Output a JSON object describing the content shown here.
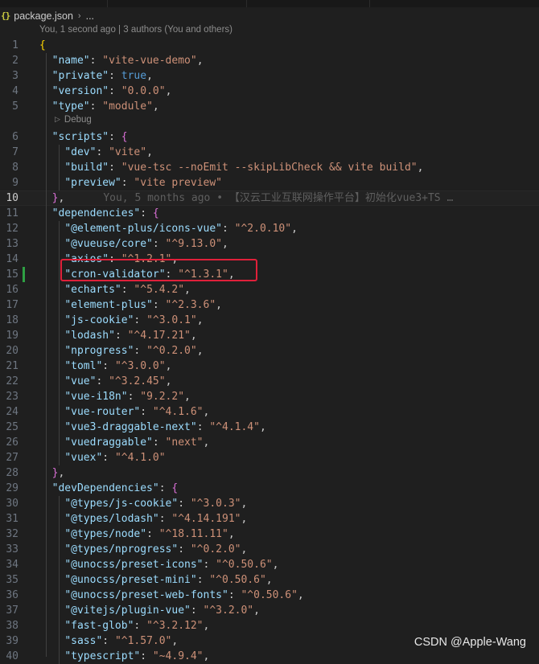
{
  "breadcrumb": {
    "file_icon": "{}",
    "file_name": "package.json",
    "separator": "›",
    "more": "..."
  },
  "blame_header": "You, 1 second ago | 3 authors (You and others)",
  "codelens": {
    "icon": "play-icon",
    "label": "Debug"
  },
  "inline_blame": "You, 5 months ago • 【汉云工业互联网操作平台】初始化vue3+TS …",
  "watermark": "CSDN @Apple-Wang",
  "colors": {
    "key": "#9cdcfe",
    "string": "#ce9178",
    "keyword": "#569cd6",
    "highlight_box": "#e0203a",
    "added_line_marker": "#2ea043"
  },
  "active_line": 10,
  "highlighted_line": 15,
  "lines": [
    {
      "n": "1",
      "t": [
        {
          "c": "br1",
          "v": "{"
        }
      ]
    },
    {
      "n": "2",
      "t": [
        {
          "c": "p",
          "v": "  "
        },
        {
          "c": "k",
          "v": "\"name\""
        },
        {
          "c": "p",
          "v": ": "
        },
        {
          "c": "s",
          "v": "\"vite-vue-demo\""
        },
        {
          "c": "p",
          "v": ","
        }
      ]
    },
    {
      "n": "3",
      "t": [
        {
          "c": "p",
          "v": "  "
        },
        {
          "c": "k",
          "v": "\"private\""
        },
        {
          "c": "p",
          "v": ": "
        },
        {
          "c": "b",
          "v": "true"
        },
        {
          "c": "p",
          "v": ","
        }
      ]
    },
    {
      "n": "4",
      "t": [
        {
          "c": "p",
          "v": "  "
        },
        {
          "c": "k",
          "v": "\"version\""
        },
        {
          "c": "p",
          "v": ": "
        },
        {
          "c": "s",
          "v": "\"0.0.0\""
        },
        {
          "c": "p",
          "v": ","
        }
      ]
    },
    {
      "n": "5",
      "t": [
        {
          "c": "p",
          "v": "  "
        },
        {
          "c": "k",
          "v": "\"type\""
        },
        {
          "c": "p",
          "v": ": "
        },
        {
          "c": "s",
          "v": "\"module\""
        },
        {
          "c": "p",
          "v": ","
        }
      ]
    },
    {
      "n": "6",
      "t": [
        {
          "c": "p",
          "v": "  "
        },
        {
          "c": "k",
          "v": "\"scripts\""
        },
        {
          "c": "p",
          "v": ": "
        },
        {
          "c": "br2",
          "v": "{"
        }
      ]
    },
    {
      "n": "7",
      "t": [
        {
          "c": "p",
          "v": "    "
        },
        {
          "c": "k",
          "v": "\"dev\""
        },
        {
          "c": "p",
          "v": ": "
        },
        {
          "c": "s",
          "v": "\"vite\""
        },
        {
          "c": "p",
          "v": ","
        }
      ]
    },
    {
      "n": "8",
      "t": [
        {
          "c": "p",
          "v": "    "
        },
        {
          "c": "k",
          "v": "\"build\""
        },
        {
          "c": "p",
          "v": ": "
        },
        {
          "c": "s",
          "v": "\"vue-tsc --noEmit --skipLibCheck && vite build\""
        },
        {
          "c": "p",
          "v": ","
        }
      ]
    },
    {
      "n": "9",
      "t": [
        {
          "c": "p",
          "v": "    "
        },
        {
          "c": "k",
          "v": "\"preview\""
        },
        {
          "c": "p",
          "v": ": "
        },
        {
          "c": "s",
          "v": "\"vite preview\""
        }
      ]
    },
    {
      "n": "10",
      "t": [
        {
          "c": "p",
          "v": "  "
        },
        {
          "c": "br2",
          "v": "}"
        },
        {
          "c": "p",
          "v": ","
        }
      ]
    },
    {
      "n": "11",
      "t": [
        {
          "c": "p",
          "v": "  "
        },
        {
          "c": "k",
          "v": "\"dependencies\""
        },
        {
          "c": "p",
          "v": ": "
        },
        {
          "c": "br2",
          "v": "{"
        }
      ]
    },
    {
      "n": "12",
      "t": [
        {
          "c": "p",
          "v": "    "
        },
        {
          "c": "k",
          "v": "\"@element-plus/icons-vue\""
        },
        {
          "c": "p",
          "v": ": "
        },
        {
          "c": "s",
          "v": "\"^2.0.10\""
        },
        {
          "c": "p",
          "v": ","
        }
      ]
    },
    {
      "n": "13",
      "t": [
        {
          "c": "p",
          "v": "    "
        },
        {
          "c": "k",
          "v": "\"@vueuse/core\""
        },
        {
          "c": "p",
          "v": ": "
        },
        {
          "c": "s",
          "v": "\"^9.13.0\""
        },
        {
          "c": "p",
          "v": ","
        }
      ]
    },
    {
      "n": "14",
      "t": [
        {
          "c": "p",
          "v": "    "
        },
        {
          "c": "k",
          "v": "\"axios\""
        },
        {
          "c": "p",
          "v": ": "
        },
        {
          "c": "s",
          "v": "\"^1.2.1\""
        },
        {
          "c": "p",
          "v": ","
        }
      ]
    },
    {
      "n": "15",
      "t": [
        {
          "c": "p",
          "v": "    "
        },
        {
          "c": "k",
          "v": "\"cron-validator\""
        },
        {
          "c": "p",
          "v": ": "
        },
        {
          "c": "s",
          "v": "\"^1.3.1\""
        },
        {
          "c": "p",
          "v": ","
        }
      ]
    },
    {
      "n": "16",
      "t": [
        {
          "c": "p",
          "v": "    "
        },
        {
          "c": "k",
          "v": "\"echarts\""
        },
        {
          "c": "p",
          "v": ": "
        },
        {
          "c": "s",
          "v": "\"^5.4.2\""
        },
        {
          "c": "p",
          "v": ","
        }
      ]
    },
    {
      "n": "17",
      "t": [
        {
          "c": "p",
          "v": "    "
        },
        {
          "c": "k",
          "v": "\"element-plus\""
        },
        {
          "c": "p",
          "v": ": "
        },
        {
          "c": "s",
          "v": "\"^2.3.6\""
        },
        {
          "c": "p",
          "v": ","
        }
      ]
    },
    {
      "n": "18",
      "t": [
        {
          "c": "p",
          "v": "    "
        },
        {
          "c": "k",
          "v": "\"js-cookie\""
        },
        {
          "c": "p",
          "v": ": "
        },
        {
          "c": "s",
          "v": "\"^3.0.1\""
        },
        {
          "c": "p",
          "v": ","
        }
      ]
    },
    {
      "n": "19",
      "t": [
        {
          "c": "p",
          "v": "    "
        },
        {
          "c": "k",
          "v": "\"lodash\""
        },
        {
          "c": "p",
          "v": ": "
        },
        {
          "c": "s",
          "v": "\"^4.17.21\""
        },
        {
          "c": "p",
          "v": ","
        }
      ]
    },
    {
      "n": "20",
      "t": [
        {
          "c": "p",
          "v": "    "
        },
        {
          "c": "k",
          "v": "\"nprogress\""
        },
        {
          "c": "p",
          "v": ": "
        },
        {
          "c": "s",
          "v": "\"^0.2.0\""
        },
        {
          "c": "p",
          "v": ","
        }
      ]
    },
    {
      "n": "21",
      "t": [
        {
          "c": "p",
          "v": "    "
        },
        {
          "c": "k",
          "v": "\"toml\""
        },
        {
          "c": "p",
          "v": ": "
        },
        {
          "c": "s",
          "v": "\"^3.0.0\""
        },
        {
          "c": "p",
          "v": ","
        }
      ]
    },
    {
      "n": "22",
      "t": [
        {
          "c": "p",
          "v": "    "
        },
        {
          "c": "k",
          "v": "\"vue\""
        },
        {
          "c": "p",
          "v": ": "
        },
        {
          "c": "s",
          "v": "\"^3.2.45\""
        },
        {
          "c": "p",
          "v": ","
        }
      ]
    },
    {
      "n": "23",
      "t": [
        {
          "c": "p",
          "v": "    "
        },
        {
          "c": "k",
          "v": "\"vue-i18n\""
        },
        {
          "c": "p",
          "v": ": "
        },
        {
          "c": "s",
          "v": "\"9.2.2\""
        },
        {
          "c": "p",
          "v": ","
        }
      ]
    },
    {
      "n": "24",
      "t": [
        {
          "c": "p",
          "v": "    "
        },
        {
          "c": "k",
          "v": "\"vue-router\""
        },
        {
          "c": "p",
          "v": ": "
        },
        {
          "c": "s",
          "v": "\"^4.1.6\""
        },
        {
          "c": "p",
          "v": ","
        }
      ]
    },
    {
      "n": "25",
      "t": [
        {
          "c": "p",
          "v": "    "
        },
        {
          "c": "k",
          "v": "\"vue3-draggable-next\""
        },
        {
          "c": "p",
          "v": ": "
        },
        {
          "c": "s",
          "v": "\"^4.1.4\""
        },
        {
          "c": "p",
          "v": ","
        }
      ]
    },
    {
      "n": "26",
      "t": [
        {
          "c": "p",
          "v": "    "
        },
        {
          "c": "k",
          "v": "\"vuedraggable\""
        },
        {
          "c": "p",
          "v": ": "
        },
        {
          "c": "s",
          "v": "\"next\""
        },
        {
          "c": "p",
          "v": ","
        }
      ]
    },
    {
      "n": "27",
      "t": [
        {
          "c": "p",
          "v": "    "
        },
        {
          "c": "k",
          "v": "\"vuex\""
        },
        {
          "c": "p",
          "v": ": "
        },
        {
          "c": "s",
          "v": "\"^4.1.0\""
        }
      ]
    },
    {
      "n": "28",
      "t": [
        {
          "c": "p",
          "v": "  "
        },
        {
          "c": "br2",
          "v": "}"
        },
        {
          "c": "p",
          "v": ","
        }
      ]
    },
    {
      "n": "29",
      "t": [
        {
          "c": "p",
          "v": "  "
        },
        {
          "c": "k",
          "v": "\"devDependencies\""
        },
        {
          "c": "p",
          "v": ": "
        },
        {
          "c": "br2",
          "v": "{"
        }
      ]
    },
    {
      "n": "30",
      "t": [
        {
          "c": "p",
          "v": "    "
        },
        {
          "c": "k",
          "v": "\"@types/js-cookie\""
        },
        {
          "c": "p",
          "v": ": "
        },
        {
          "c": "s",
          "v": "\"^3.0.3\""
        },
        {
          "c": "p",
          "v": ","
        }
      ]
    },
    {
      "n": "31",
      "t": [
        {
          "c": "p",
          "v": "    "
        },
        {
          "c": "k",
          "v": "\"@types/lodash\""
        },
        {
          "c": "p",
          "v": ": "
        },
        {
          "c": "s",
          "v": "\"^4.14.191\""
        },
        {
          "c": "p",
          "v": ","
        }
      ]
    },
    {
      "n": "32",
      "t": [
        {
          "c": "p",
          "v": "    "
        },
        {
          "c": "k",
          "v": "\"@types/node\""
        },
        {
          "c": "p",
          "v": ": "
        },
        {
          "c": "s",
          "v": "\"^18.11.11\""
        },
        {
          "c": "p",
          "v": ","
        }
      ]
    },
    {
      "n": "33",
      "t": [
        {
          "c": "p",
          "v": "    "
        },
        {
          "c": "k",
          "v": "\"@types/nprogress\""
        },
        {
          "c": "p",
          "v": ": "
        },
        {
          "c": "s",
          "v": "\"^0.2.0\""
        },
        {
          "c": "p",
          "v": ","
        }
      ]
    },
    {
      "n": "34",
      "t": [
        {
          "c": "p",
          "v": "    "
        },
        {
          "c": "k",
          "v": "\"@unocss/preset-icons\""
        },
        {
          "c": "p",
          "v": ": "
        },
        {
          "c": "s",
          "v": "\"^0.50.6\""
        },
        {
          "c": "p",
          "v": ","
        }
      ]
    },
    {
      "n": "35",
      "t": [
        {
          "c": "p",
          "v": "    "
        },
        {
          "c": "k",
          "v": "\"@unocss/preset-mini\""
        },
        {
          "c": "p",
          "v": ": "
        },
        {
          "c": "s",
          "v": "\"^0.50.6\""
        },
        {
          "c": "p",
          "v": ","
        }
      ]
    },
    {
      "n": "36",
      "t": [
        {
          "c": "p",
          "v": "    "
        },
        {
          "c": "k",
          "v": "\"@unocss/preset-web-fonts\""
        },
        {
          "c": "p",
          "v": ": "
        },
        {
          "c": "s",
          "v": "\"^0.50.6\""
        },
        {
          "c": "p",
          "v": ","
        }
      ]
    },
    {
      "n": "37",
      "t": [
        {
          "c": "p",
          "v": "    "
        },
        {
          "c": "k",
          "v": "\"@vitejs/plugin-vue\""
        },
        {
          "c": "p",
          "v": ": "
        },
        {
          "c": "s",
          "v": "\"^3.2.0\""
        },
        {
          "c": "p",
          "v": ","
        }
      ]
    },
    {
      "n": "38",
      "t": [
        {
          "c": "p",
          "v": "    "
        },
        {
          "c": "k",
          "v": "\"fast-glob\""
        },
        {
          "c": "p",
          "v": ": "
        },
        {
          "c": "s",
          "v": "\"^3.2.12\""
        },
        {
          "c": "p",
          "v": ","
        }
      ]
    },
    {
      "n": "39",
      "t": [
        {
          "c": "p",
          "v": "    "
        },
        {
          "c": "k",
          "v": "\"sass\""
        },
        {
          "c": "p",
          "v": ": "
        },
        {
          "c": "s",
          "v": "\"^1.57.0\""
        },
        {
          "c": "p",
          "v": ","
        }
      ]
    },
    {
      "n": "40",
      "t": [
        {
          "c": "p",
          "v": "    "
        },
        {
          "c": "k",
          "v": "\"typescript\""
        },
        {
          "c": "p",
          "v": ": "
        },
        {
          "c": "s",
          "v": "\"~4.9.4\""
        },
        {
          "c": "p",
          "v": ","
        }
      ]
    }
  ]
}
